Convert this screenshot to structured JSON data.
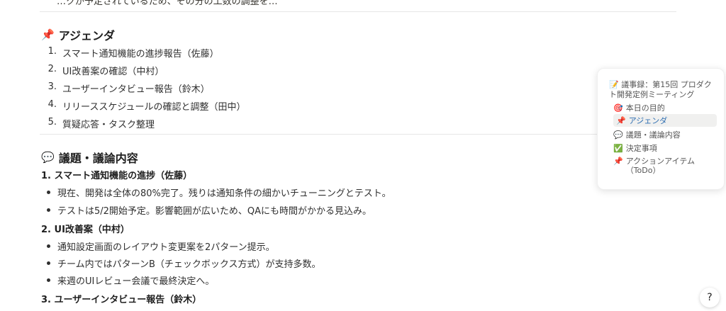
{
  "top_partial_line": "…クが予定されているため、その分の工数の調整を…",
  "sections": {
    "agenda": {
      "icon": "pushpin-icon",
      "emoji": "📌",
      "title": "アジェンダ",
      "items": [
        {
          "n": "1.",
          "text": "スマート通知機能の進捗報告（佐藤）"
        },
        {
          "n": "2.",
          "text": "UI改善案の確認（中村）"
        },
        {
          "n": "3.",
          "text": "ユーザーインタビュー報告（鈴木）"
        },
        {
          "n": "4.",
          "text": "リリーススケジュールの確認と調整（田中）"
        },
        {
          "n": "5.",
          "text": "質疑応答・タスク整理"
        }
      ]
    },
    "discussion": {
      "icon": "speech-bubble-icon",
      "emoji": "💬",
      "title": "議題・議論内容",
      "topics": [
        {
          "title": "1. スマート通知機能の進捗（佐藤）",
          "bullets": [
            "現在、開発は全体の80%完了。残りは通知条件の細かいチューニングとテスト。",
            "テストは5/2開始予定。影響範囲が広いため、QAにも時間がかかる見込み。"
          ]
        },
        {
          "title": "2. UI改善案（中村）",
          "bullets": [
            "通知設定画面のレイアウト変更案を2パターン提示。",
            "チーム内ではパターンB（チェックボックス方式）が支持多数。",
            "来週のUIレビュー会議で最終決定へ。"
          ]
        },
        {
          "title": "3. ユーザーインタビュー報告（鈴木）",
          "bullets": []
        }
      ]
    }
  },
  "toc": {
    "title_emoji": "📝",
    "title": "議事録：第15回 プロダクト開発定例ミーティング",
    "items": [
      {
        "emoji": "🎯",
        "label": "本日の目的",
        "active": false
      },
      {
        "emoji": "📌",
        "label": "アジェンダ",
        "active": true
      },
      {
        "emoji": "💬",
        "label": "議題・議論内容",
        "active": false
      },
      {
        "emoji": "✅",
        "label": "決定事項",
        "active": false
      },
      {
        "emoji": "📌",
        "label": "アクションアイテム（ToDo）",
        "active": false
      }
    ]
  },
  "floating_button": {
    "icon": "help-icon",
    "glyph": "?"
  }
}
